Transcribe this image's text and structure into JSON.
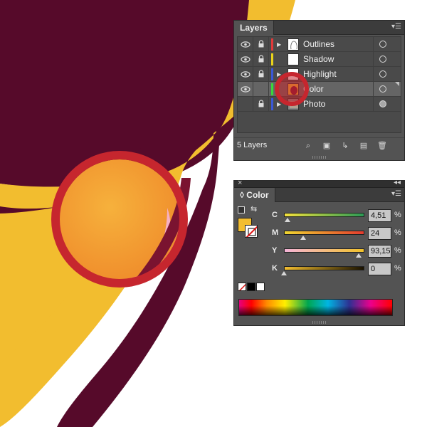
{
  "colors": {
    "maroon": "#560a2a",
    "gold": "#f2bd2f",
    "highlight_circle": "#c6262e",
    "panel_bg": "#535353"
  },
  "layers_panel": {
    "tab_label": "Layers",
    "menu_icon": "panel-menu-icon",
    "layers": [
      {
        "name": "Outlines",
        "visible": true,
        "locked": true,
        "color": "#e23a3a",
        "expandable": true,
        "target": "hollow",
        "selected": false
      },
      {
        "name": "Shadow",
        "visible": true,
        "locked": true,
        "color": "#e8d21b",
        "expandable": false,
        "target": "hollow",
        "selected": false
      },
      {
        "name": "Highlight",
        "visible": true,
        "locked": true,
        "color": "#3a58d6",
        "expandable": true,
        "target": "hollow",
        "selected": false
      },
      {
        "name": "Color",
        "visible": true,
        "locked": false,
        "color": "#3bd63b",
        "expandable": false,
        "target": "hollow",
        "selected": true
      },
      {
        "name": "Photo",
        "visible": false,
        "locked": true,
        "color": "#3a58d6",
        "expandable": true,
        "target": "filled",
        "selected": false
      }
    ],
    "layer_count": "5 Layers",
    "footer_icons": [
      "locate-object-icon",
      "make-clipping-mask-icon",
      "create-sublayer-icon",
      "new-layer-icon",
      "trash-icon"
    ]
  },
  "color_panel": {
    "tab_label": "Color",
    "close_glyph": "×",
    "collapse_glyph": "◂◂",
    "fill_color": "#f2bd2f",
    "sliders": [
      {
        "label": "C",
        "value": "4,51",
        "unit": "%",
        "fraction": 0.045,
        "gradient": "linear-gradient(to right, #f4e23c, #2b9a55)"
      },
      {
        "label": "M",
        "value": "24",
        "unit": "%",
        "fraction": 0.24,
        "gradient": "linear-gradient(to right, #f0d630, #e33b2e)"
      },
      {
        "label": "Y",
        "value": "93,15",
        "unit": "%",
        "fraction": 0.93,
        "gradient": "linear-gradient(to right, #f4b4d8, #f2c22a)"
      },
      {
        "label": "K",
        "value": "0",
        "unit": "%",
        "fraction": 0.0,
        "gradient": "linear-gradient(to right, #f2bd2f, #1a1200)"
      }
    ],
    "mini_swatches": [
      "none",
      "#000000",
      "#ffffff"
    ]
  }
}
